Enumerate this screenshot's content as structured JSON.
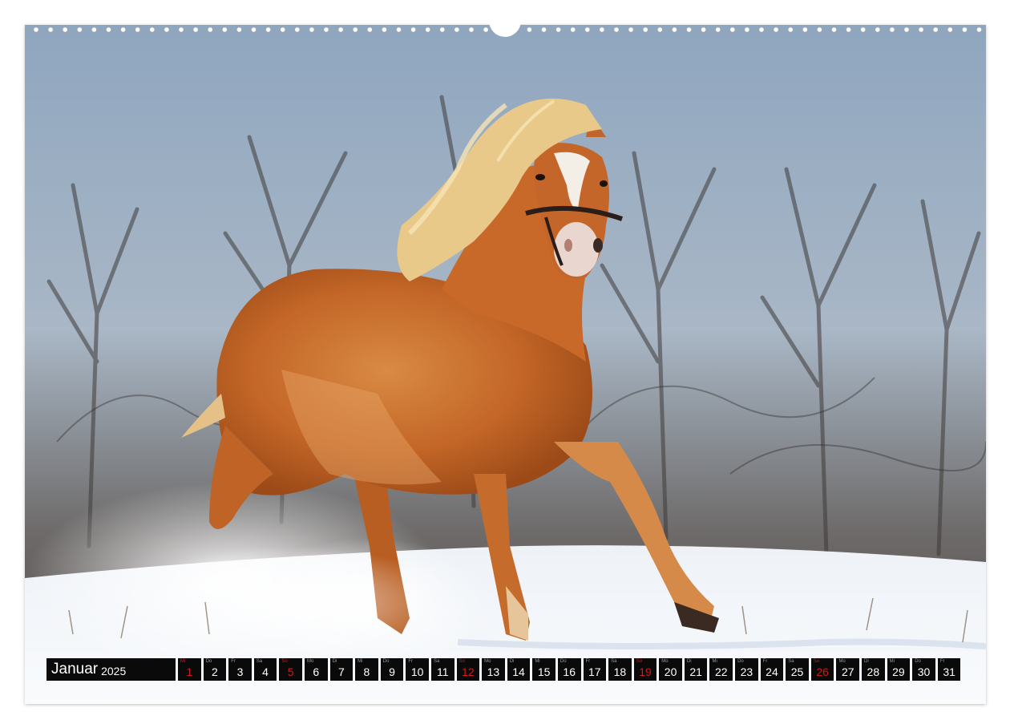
{
  "calendar": {
    "month": "Januar",
    "year": "2025",
    "days": [
      {
        "wd": "Mi",
        "num": "1",
        "red": true
      },
      {
        "wd": "Do",
        "num": "2",
        "red": false
      },
      {
        "wd": "Fr",
        "num": "3",
        "red": false
      },
      {
        "wd": "Sa",
        "num": "4",
        "red": false
      },
      {
        "wd": "So",
        "num": "5",
        "red": true
      },
      {
        "wd": "Mo",
        "num": "6",
        "red": false
      },
      {
        "wd": "Di",
        "num": "7",
        "red": false
      },
      {
        "wd": "Mi",
        "num": "8",
        "red": false
      },
      {
        "wd": "Do",
        "num": "9",
        "red": false
      },
      {
        "wd": "Fr",
        "num": "10",
        "red": false
      },
      {
        "wd": "Sa",
        "num": "11",
        "red": false
      },
      {
        "wd": "So",
        "num": "12",
        "red": true
      },
      {
        "wd": "Mo",
        "num": "13",
        "red": false
      },
      {
        "wd": "Di",
        "num": "14",
        "red": false
      },
      {
        "wd": "Mi",
        "num": "15",
        "red": false
      },
      {
        "wd": "Do",
        "num": "16",
        "red": false
      },
      {
        "wd": "Fr",
        "num": "17",
        "red": false
      },
      {
        "wd": "Sa",
        "num": "18",
        "red": false
      },
      {
        "wd": "So",
        "num": "19",
        "red": true
      },
      {
        "wd": "Mo",
        "num": "20",
        "red": false
      },
      {
        "wd": "Di",
        "num": "21",
        "red": false
      },
      {
        "wd": "Mi",
        "num": "22",
        "red": false
      },
      {
        "wd": "Do",
        "num": "23",
        "red": false
      },
      {
        "wd": "Fr",
        "num": "24",
        "red": false
      },
      {
        "wd": "Sa",
        "num": "25",
        "red": false
      },
      {
        "wd": "So",
        "num": "26",
        "red": true
      },
      {
        "wd": "Mo",
        "num": "27",
        "red": false
      },
      {
        "wd": "Di",
        "num": "28",
        "red": false
      },
      {
        "wd": "Mi",
        "num": "29",
        "red": false
      },
      {
        "wd": "Do",
        "num": "30",
        "red": false
      },
      {
        "wd": "Fr",
        "num": "31",
        "red": false
      }
    ]
  },
  "colors": {
    "strip_background": "#0a0a0a",
    "holiday_red": "#d21a1a",
    "horse_coat": "#c76a2a",
    "mane": "#e8c98a"
  }
}
